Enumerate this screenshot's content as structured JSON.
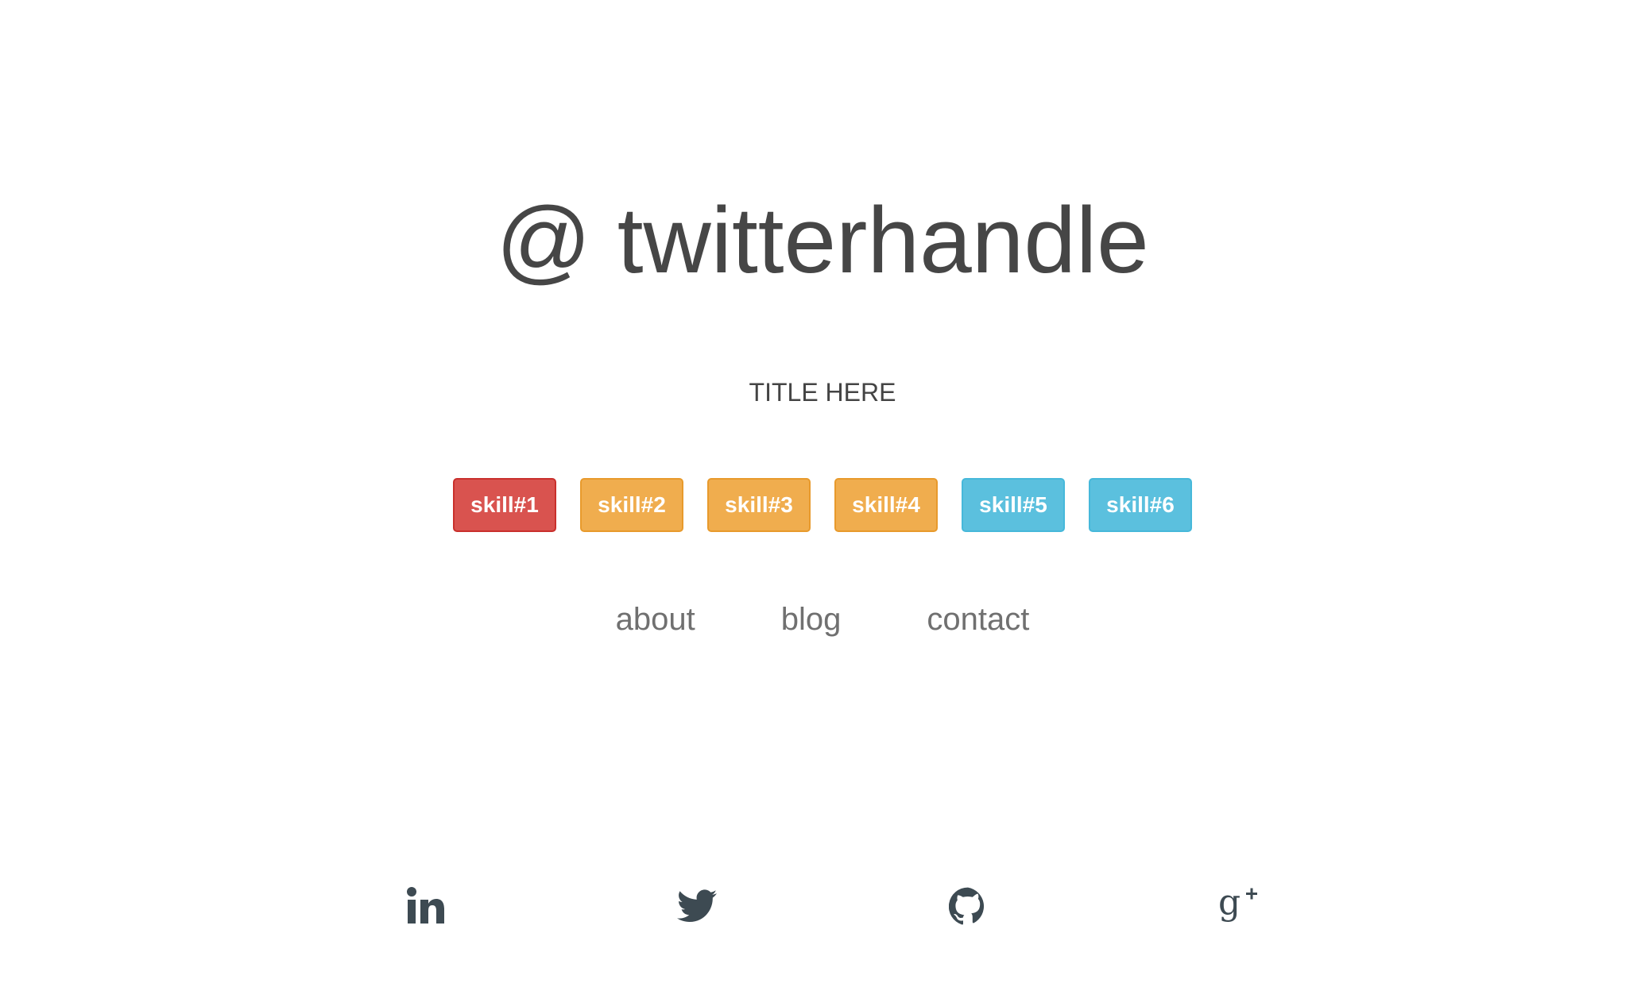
{
  "header": {
    "handle": "@ twitterhandle",
    "title": "TITLE HERE"
  },
  "skills": [
    {
      "label": "skill#1",
      "color": "#d9534f"
    },
    {
      "label": "skill#2",
      "color": "#f0ad4e"
    },
    {
      "label": "skill#3",
      "color": "#f0ad4e"
    },
    {
      "label": "skill#4",
      "color": "#f0ad4e"
    },
    {
      "label": "skill#5",
      "color": "#5bc0de"
    },
    {
      "label": "skill#6",
      "color": "#5bc0de"
    }
  ],
  "nav": {
    "about": "about",
    "blog": "blog",
    "contact": "contact"
  },
  "social": [
    {
      "icon": "linkedin-icon"
    },
    {
      "icon": "twitter-icon"
    },
    {
      "icon": "github-icon"
    },
    {
      "icon": "google-plus-icon"
    }
  ],
  "colors": {
    "text": "#464646",
    "nav": "#707070",
    "icons": "#3d4a52"
  }
}
